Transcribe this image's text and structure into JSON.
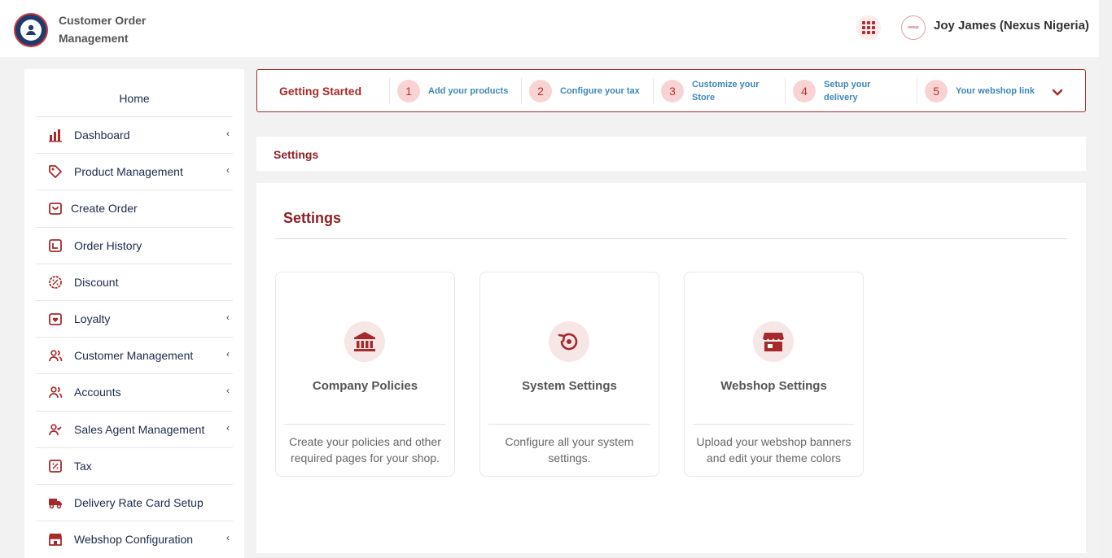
{
  "header": {
    "app_title": "Customer Order Management",
    "user_name": "Joy James (Nexus Nigeria)",
    "avatar_text": "nexus"
  },
  "sidebar": {
    "home_label": "Home",
    "items": [
      {
        "label": "Dashboard",
        "icon": "bar-chart-icon",
        "has_submenu": true
      },
      {
        "label": "Product Management",
        "icon": "tag-icon",
        "has_submenu": true
      },
      {
        "label": "Create Order",
        "icon": "shopping-bag-icon",
        "has_submenu": false
      },
      {
        "label": "Order History",
        "icon": "history-icon",
        "has_submenu": false
      },
      {
        "label": "Discount",
        "icon": "discount-badge-icon",
        "has_submenu": false
      },
      {
        "label": "Loyalty",
        "icon": "loyalty-bag-icon",
        "has_submenu": true
      },
      {
        "label": "Customer Management",
        "icon": "users-icon",
        "has_submenu": true
      },
      {
        "label": "Accounts",
        "icon": "accounts-icon",
        "has_submenu": true
      },
      {
        "label": "Sales Agent Management",
        "icon": "user-check-icon",
        "has_submenu": true
      },
      {
        "label": "Tax",
        "icon": "percent-square-icon",
        "has_submenu": false
      },
      {
        "label": "Delivery Rate Card Setup",
        "icon": "truck-icon",
        "has_submenu": false
      },
      {
        "label": "Webshop Configuration",
        "icon": "store-icon",
        "has_submenu": true
      }
    ]
  },
  "getting_started": {
    "title": "Getting Started",
    "steps": [
      {
        "num": "1",
        "label": "Add your products"
      },
      {
        "num": "2",
        "label": "Configure your tax"
      },
      {
        "num": "3",
        "label": "Customize your Store"
      },
      {
        "num": "4",
        "label": "Setup your delivery"
      },
      {
        "num": "5",
        "label": "Your webshop link"
      }
    ]
  },
  "breadcrumb": "Settings",
  "main": {
    "title": "Settings",
    "cards": [
      {
        "title": "Company Policies",
        "desc": "Create your policies and other required pages for your shop.",
        "icon": "bank-icon"
      },
      {
        "title": "System Settings",
        "desc": "Configure all your system settings.",
        "icon": "settings-restore-icon"
      },
      {
        "title": "Webshop Settings",
        "desc": "Upload your webshop banners and edit your theme colors",
        "icon": "storefront-icon"
      }
    ]
  },
  "colors": {
    "brand": "#8e1f24",
    "accent": "#a72a2a",
    "link": "#3c87b8",
    "step_bg": "#f9d3d3"
  }
}
